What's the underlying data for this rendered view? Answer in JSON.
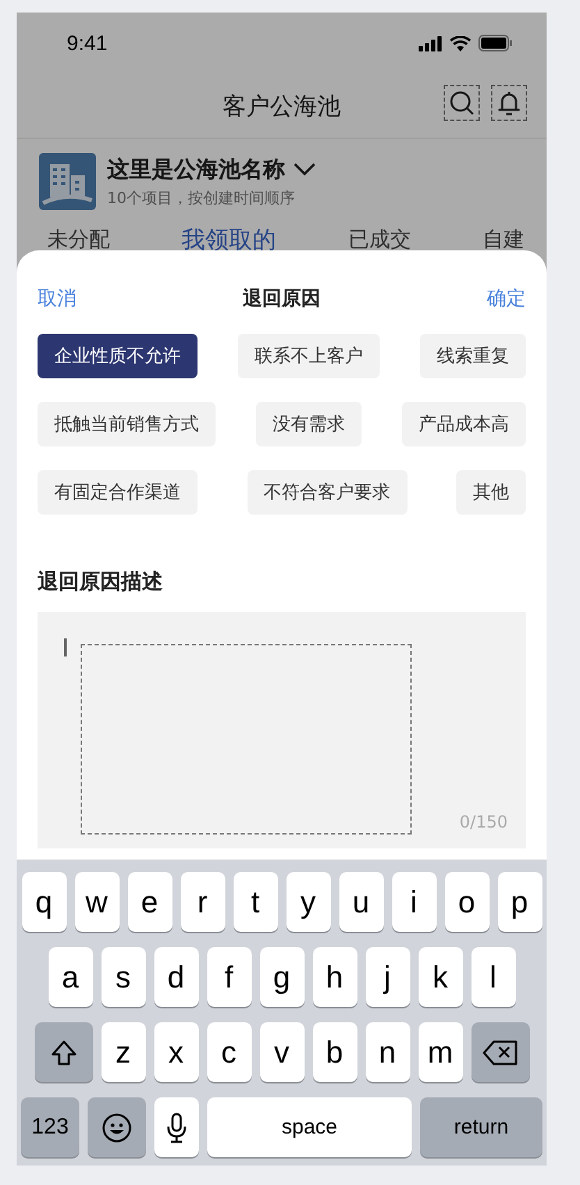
{
  "status_bar": {
    "time": "9:41"
  },
  "nav": {
    "title": "客户公海池"
  },
  "pool": {
    "name": "这里是公海池名称",
    "subtitle": "10个项目，按创建时间顺序"
  },
  "tabs": [
    {
      "label": "未分配",
      "selected": false
    },
    {
      "label": "我领取的",
      "selected": true
    },
    {
      "label": "已成交",
      "selected": false
    },
    {
      "label": "自建",
      "selected": false
    }
  ],
  "sheet": {
    "cancel": "取消",
    "title": "退回原因",
    "confirm": "确定",
    "reasons": [
      {
        "label": "企业性质不允许",
        "selected": true
      },
      {
        "label": "联系不上客户",
        "selected": false
      },
      {
        "label": "线索重复",
        "selected": false
      },
      {
        "label": "抵触当前销售方式",
        "selected": false
      },
      {
        "label": "没有需求",
        "selected": false
      },
      {
        "label": "产品成本高",
        "selected": false
      },
      {
        "label": "有固定合作渠道",
        "selected": false
      },
      {
        "label": "不符合客户要求",
        "selected": false
      },
      {
        "label": "其他",
        "selected": false
      }
    ],
    "description_label": "退回原因描述",
    "counter": "0/150"
  },
  "keyboard": {
    "rows": [
      {
        "keys": [
          {
            "kind": "letter",
            "label": "q"
          },
          {
            "kind": "letter",
            "label": "w"
          },
          {
            "kind": "letter",
            "label": "e"
          },
          {
            "kind": "letter",
            "label": "r"
          },
          {
            "kind": "letter",
            "label": "t"
          },
          {
            "kind": "letter",
            "label": "y"
          },
          {
            "kind": "letter",
            "label": "u"
          },
          {
            "kind": "letter",
            "label": "i"
          },
          {
            "kind": "letter",
            "label": "o"
          },
          {
            "kind": "letter",
            "label": "p"
          }
        ]
      },
      {
        "keys": [
          {
            "kind": "letter",
            "label": "a"
          },
          {
            "kind": "letter",
            "label": "s"
          },
          {
            "kind": "letter",
            "label": "d"
          },
          {
            "kind": "letter",
            "label": "f"
          },
          {
            "kind": "letter",
            "label": "g"
          },
          {
            "kind": "letter",
            "label": "h"
          },
          {
            "kind": "letter",
            "label": "j"
          },
          {
            "kind": "letter",
            "label": "k"
          },
          {
            "kind": "letter",
            "label": "l"
          }
        ]
      },
      {
        "keys": [
          {
            "kind": "shift"
          },
          {
            "kind": "letter",
            "label": "z"
          },
          {
            "kind": "letter",
            "label": "x"
          },
          {
            "kind": "letter",
            "label": "c"
          },
          {
            "kind": "letter",
            "label": "v"
          },
          {
            "kind": "letter",
            "label": "b"
          },
          {
            "kind": "letter",
            "label": "n"
          },
          {
            "kind": "letter",
            "label": "m"
          },
          {
            "kind": "delete"
          }
        ]
      },
      {
        "keys": [
          {
            "kind": "numbers",
            "label": "123"
          },
          {
            "kind": "emoji"
          },
          {
            "kind": "mic"
          },
          {
            "kind": "space",
            "label": "space"
          },
          {
            "kind": "return",
            "label": "return"
          }
        ]
      }
    ]
  }
}
